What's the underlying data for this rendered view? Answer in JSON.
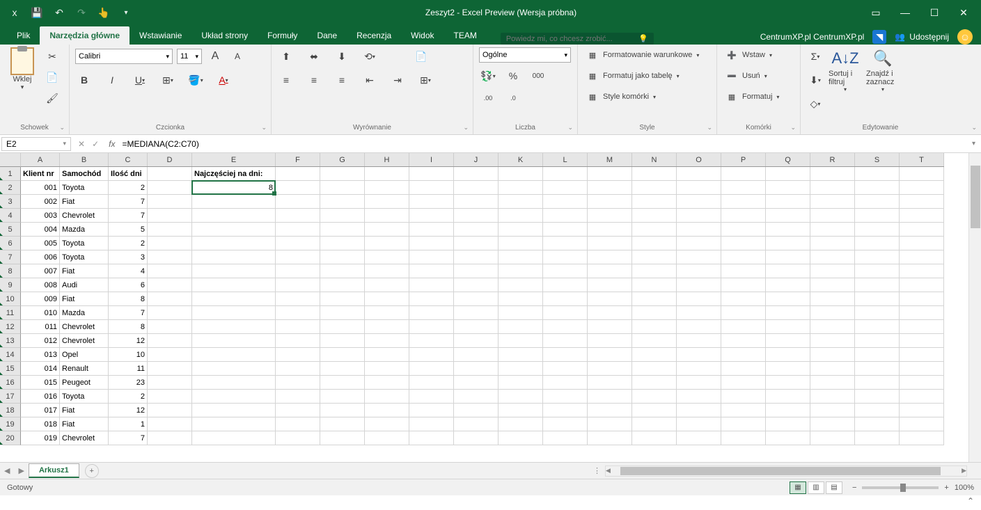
{
  "title": "Zeszyt2 - Excel Preview (Wersja próbna)",
  "tabs": [
    "Plik",
    "Narzędzia główne",
    "Wstawianie",
    "Układ strony",
    "Formuły",
    "Dane",
    "Recenzja",
    "Widok",
    "TEAM"
  ],
  "active_tab": 1,
  "tellme_placeholder": "Powiedz mi, co chcesz zrobić...",
  "user": "CentrumXP.pl CentrumXP.pl",
  "share_label": "Udostępnij",
  "groups": {
    "clipboard": {
      "label": "Schowek",
      "paste": "Wklej"
    },
    "font": {
      "label": "Czcionka",
      "name": "Calibri",
      "size": "11"
    },
    "align": {
      "label": "Wyrównanie"
    },
    "number": {
      "label": "Liczba",
      "format": "Ogólne"
    },
    "styles": {
      "label": "Style",
      "cond": "Formatowanie warunkowe",
      "table": "Formatuj jako tabelę",
      "cell": "Style komórki"
    },
    "cells": {
      "label": "Komórki",
      "insert": "Wstaw",
      "delete": "Usuń",
      "format": "Formatuj"
    },
    "editing": {
      "label": "Edytowanie",
      "sort": "Sortuj i filtruj",
      "find": "Znajdź i zaznacz"
    }
  },
  "namebox": "E2",
  "formula": "=MEDIANA(C2:C70)",
  "columns": [
    "A",
    "B",
    "C",
    "D",
    "E",
    "F",
    "G",
    "H",
    "I",
    "J",
    "K",
    "L",
    "M",
    "N",
    "O",
    "P",
    "Q",
    "R",
    "S",
    "T"
  ],
  "col_widths": {
    "A": 56,
    "B": 70,
    "C": 56,
    "D": 64,
    "E": 120
  },
  "headers": {
    "A": "Klient nr",
    "B": "Samochód",
    "C": "Ilość dni",
    "E1": "Najczęściej na dni:",
    "E2": "8"
  },
  "rows": [
    {
      "n": "001",
      "car": "Toyota",
      "d": "2"
    },
    {
      "n": "002",
      "car": "Fiat",
      "d": "7"
    },
    {
      "n": "003",
      "car": "Chevrolet",
      "d": "7"
    },
    {
      "n": "004",
      "car": "Mazda",
      "d": "5"
    },
    {
      "n": "005",
      "car": "Toyota",
      "d": "2"
    },
    {
      "n": "006",
      "car": "Toyota",
      "d": "3"
    },
    {
      "n": "007",
      "car": "Fiat",
      "d": "4"
    },
    {
      "n": "008",
      "car": "Audi",
      "d": "6"
    },
    {
      "n": "009",
      "car": "Fiat",
      "d": "8"
    },
    {
      "n": "010",
      "car": "Mazda",
      "d": "7"
    },
    {
      "n": "011",
      "car": "Chevrolet",
      "d": "8"
    },
    {
      "n": "012",
      "car": "Chevrolet",
      "d": "12"
    },
    {
      "n": "013",
      "car": "Opel",
      "d": "10"
    },
    {
      "n": "014",
      "car": "Renault",
      "d": "11"
    },
    {
      "n": "015",
      "car": "Peugeot",
      "d": "23"
    },
    {
      "n": "016",
      "car": "Toyota",
      "d": "2"
    },
    {
      "n": "017",
      "car": "Fiat",
      "d": "12"
    },
    {
      "n": "018",
      "car": "Fiat",
      "d": "1"
    },
    {
      "n": "019",
      "car": "Chevrolet",
      "d": "7"
    }
  ],
  "sheet": "Arkusz1",
  "status": "Gotowy",
  "zoom": "100%"
}
